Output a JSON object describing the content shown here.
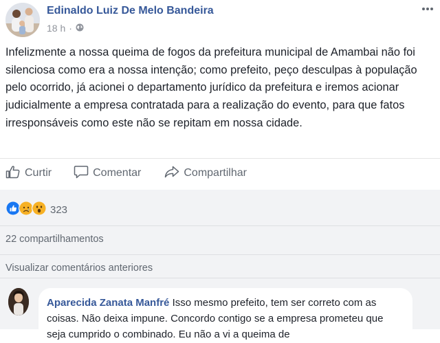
{
  "post": {
    "author": "Edinaldo Luiz De Melo Bandeira",
    "time": "18 h",
    "separator": "·",
    "privacy_icon": "globe-icon",
    "more_icon": "more-options-icon",
    "text": "Infelizmente a nossa queima de fogos da prefeitura municipal de Amambai não foi silenciosa como era a nossa intenção; como prefeito, peço desculpas à população pelo ocorrido, já acionei o departamento jurídico da prefeitura e iremos acionar judicialmente a empresa contratada para a realização do evento, para que fatos irresponsáveis como este não se repitam em nossa cidade."
  },
  "actions": {
    "like_label": "Curtir",
    "comment_label": "Comentar",
    "share_label": "Compartilhar"
  },
  "reactions": {
    "icons": [
      "like-reaction-icon",
      "sad-reaction-icon",
      "wow-reaction-icon"
    ],
    "count": "323"
  },
  "shares": "22 compartilhamentos",
  "previous_comments": "Visualizar comentários anteriores",
  "comment": {
    "author": "Aparecida Zanata Manfré",
    "text": "Isso mesmo prefeito, tem ser correto com as coisas. Não deixa impune. Concordo contigo se a empresa prometeu que seja cumprido o combinado. Eu não a vi a queima de"
  },
  "colors": {
    "link_blue": "#365899",
    "like_blue": "#1877f2",
    "reaction_yellow": "#f7b125",
    "feedback_bg": "#f2f3f5",
    "muted_text": "#606770"
  }
}
